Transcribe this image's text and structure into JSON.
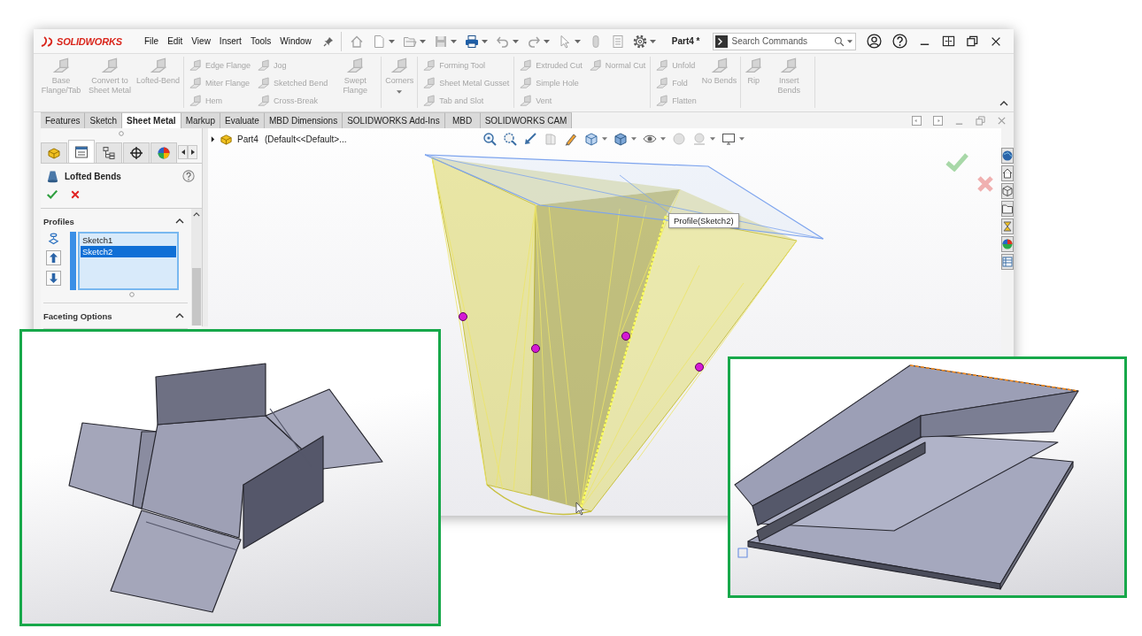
{
  "app": {
    "logo": "SOLIDWORKS"
  },
  "menu": [
    "File",
    "Edit",
    "View",
    "Insert",
    "Tools",
    "Window"
  ],
  "document_title": "Part4 *",
  "search": {
    "placeholder": "Search Commands"
  },
  "ribbon": {
    "expanded": true,
    "groups": [
      {
        "columns": [
          {
            "kind": "large",
            "label": "Base Flange/Tab",
            "disabled": true
          },
          {
            "kind": "large",
            "label": "Convert to Sheet Metal",
            "disabled": true
          },
          {
            "kind": "large",
            "label": "Lofted-Bend",
            "disabled": true
          }
        ]
      },
      {
        "columns": [
          {
            "kind": "stack",
            "items": [
              {
                "label": "Edge Flange",
                "disabled": true
              },
              {
                "label": "Miter Flange",
                "disabled": true
              },
              {
                "label": "Hem",
                "disabled": true
              }
            ]
          },
          {
            "kind": "stack",
            "items": [
              {
                "label": "Jog",
                "disabled": true
              },
              {
                "label": "Sketched Bend",
                "disabled": true
              },
              {
                "label": "Cross-Break",
                "disabled": true
              }
            ]
          },
          {
            "kind": "large",
            "label": "Swept Flange",
            "disabled": true
          }
        ]
      },
      {
        "columns": [
          {
            "kind": "flyout",
            "label": "Corners",
            "disabled": true
          }
        ]
      },
      {
        "columns": [
          {
            "kind": "stack",
            "items": [
              {
                "label": "Forming Tool",
                "disabled": true
              },
              {
                "label": "Sheet Metal Gusset",
                "disabled": true
              },
              {
                "label": "Tab and Slot",
                "disabled": true
              }
            ]
          }
        ]
      },
      {
        "columns": [
          {
            "kind": "stack",
            "items": [
              {
                "label": "Extruded Cut",
                "disabled": true
              },
              {
                "label": "Simple Hole",
                "disabled": true
              },
              {
                "label": "Vent",
                "disabled": true
              }
            ]
          },
          {
            "kind": "stack",
            "items": [
              {
                "label": "Normal Cut",
                "disabled": true
              }
            ]
          }
        ]
      },
      {
        "columns": [
          {
            "kind": "stack",
            "items": [
              {
                "label": "Unfold",
                "disabled": true
              },
              {
                "label": "Fold",
                "disabled": true
              },
              {
                "label": "Flatten",
                "disabled": true
              }
            ]
          },
          {
            "kind": "large",
            "label": "No Bends",
            "disabled": true
          }
        ]
      },
      {
        "columns": [
          {
            "kind": "large",
            "label": "Rip",
            "disabled": true
          },
          {
            "kind": "large",
            "label": "Insert Bends",
            "disabled": true
          }
        ]
      }
    ]
  },
  "tabs": [
    {
      "label": "Features",
      "selected": false
    },
    {
      "label": "Sketch",
      "selected": false
    },
    {
      "label": "Sheet Metal",
      "selected": true
    },
    {
      "label": "Markup",
      "selected": false
    },
    {
      "label": "Evaluate",
      "selected": false
    },
    {
      "label": "MBD Dimensions",
      "selected": false
    },
    {
      "label": "SOLIDWORKS Add-Ins",
      "selected": false
    },
    {
      "label": "MBD",
      "selected": false
    },
    {
      "label": "SOLIDWORKS CAM",
      "selected": false
    }
  ],
  "panel_tabs": [
    {
      "selected": false
    },
    {
      "selected": true
    },
    {
      "selected": false
    },
    {
      "selected": false
    },
    {
      "selected": false
    }
  ],
  "property_manager": {
    "title": "Lofted Bends",
    "sections": [
      {
        "title": "Profiles",
        "expanded": true,
        "profiles": [
          {
            "label": "Sketch1",
            "selected": false
          },
          {
            "label": "Sketch2",
            "selected": true
          }
        ]
      },
      {
        "title": "Faceting Options",
        "expanded": true
      }
    ]
  },
  "graphics": {
    "tree": {
      "part": "Part4",
      "configuration": "(Default<<Default>...",
      "expanded": false
    },
    "tooltip": "Profile(Sketch2)"
  }
}
